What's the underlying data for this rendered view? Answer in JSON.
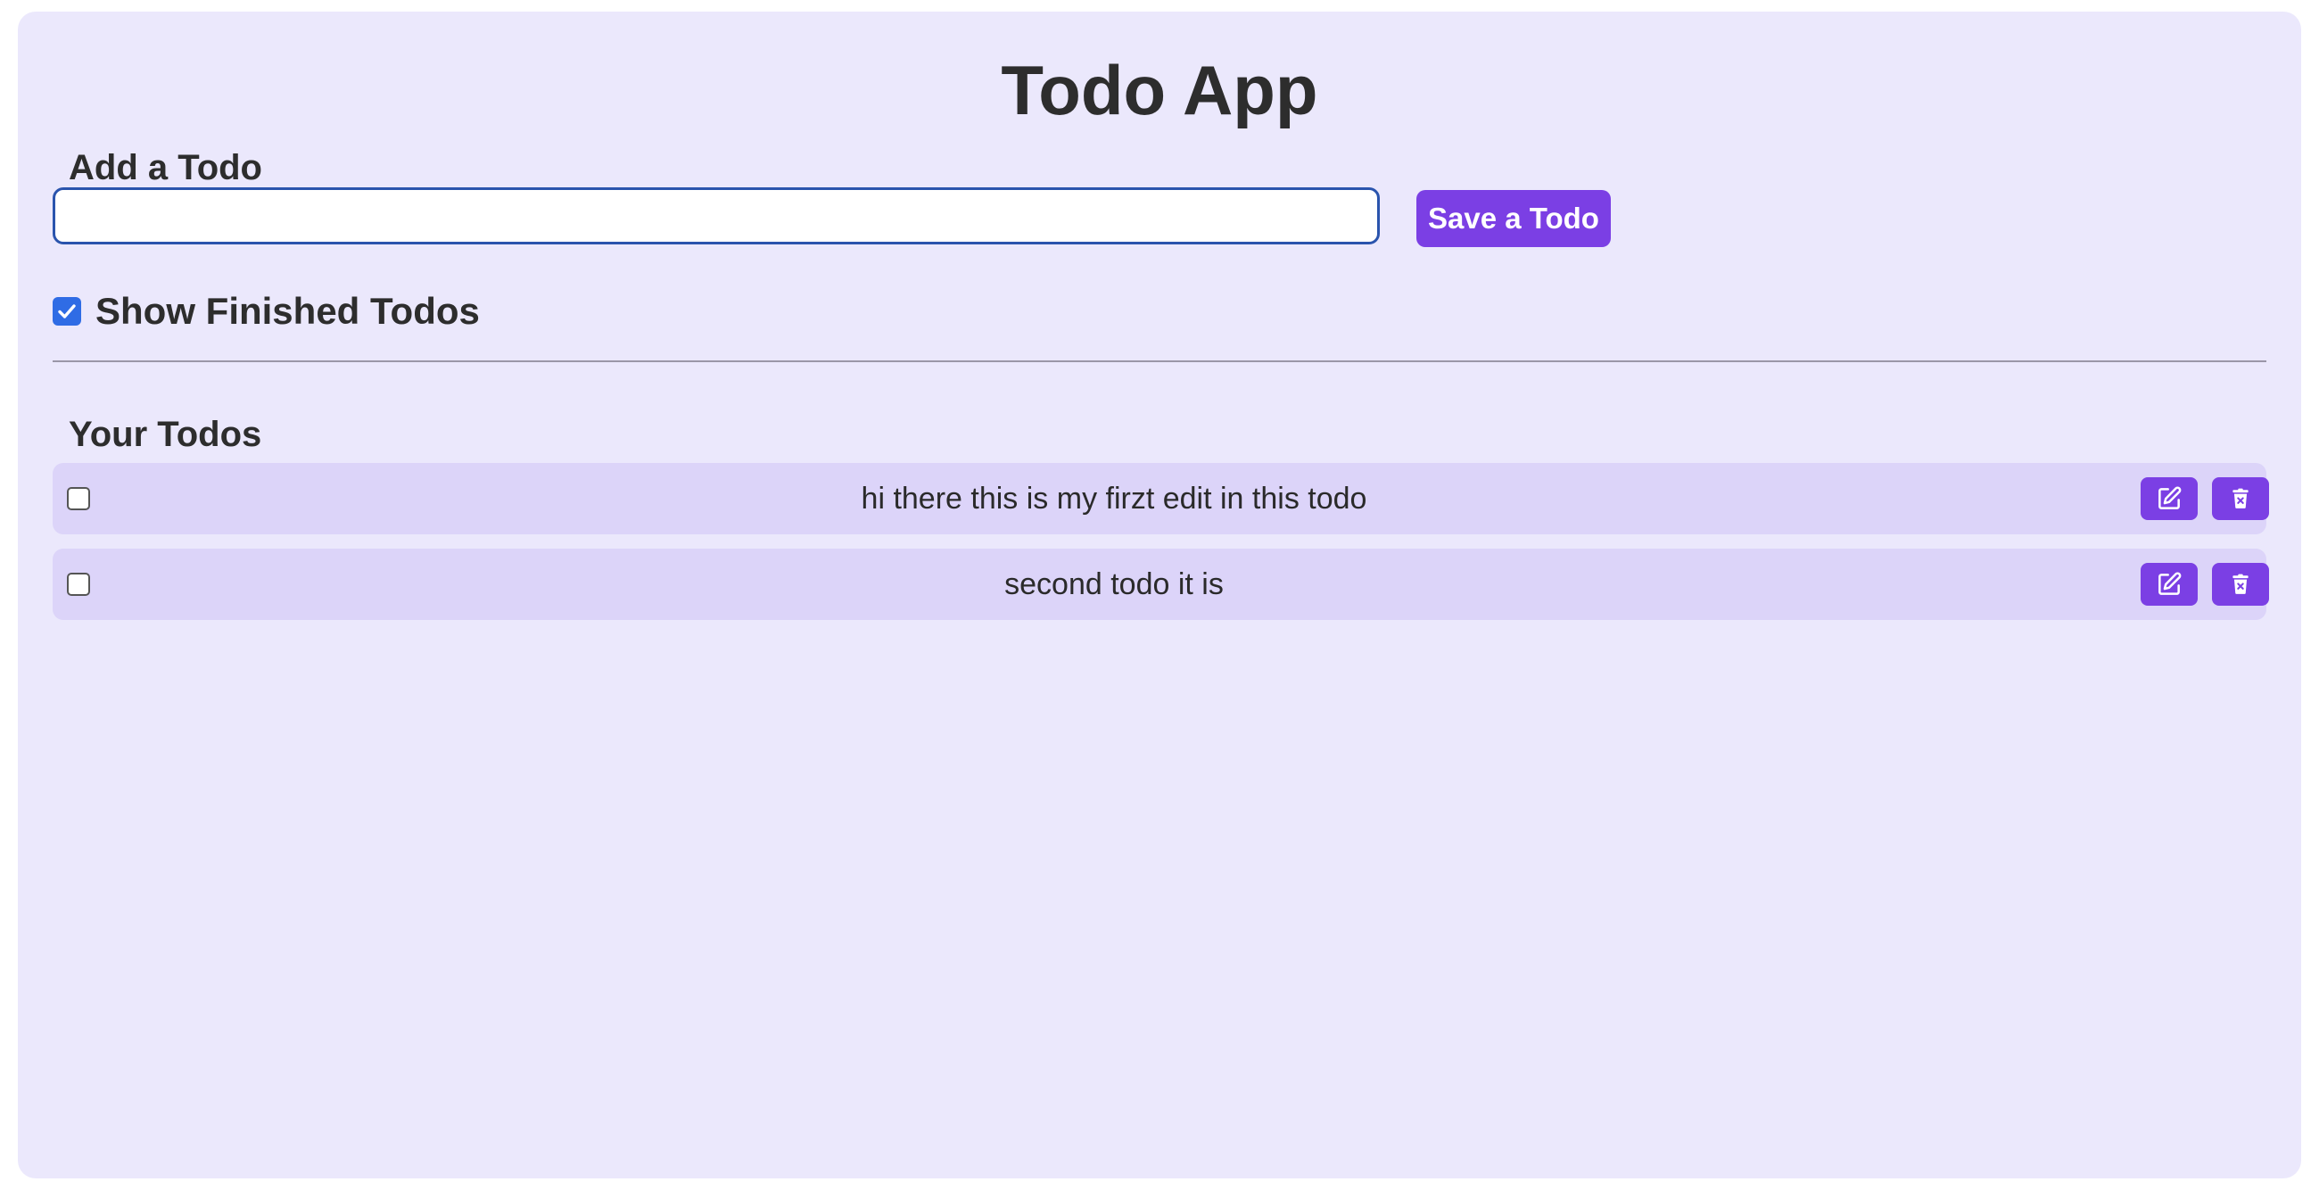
{
  "app": {
    "title": "Todo App"
  },
  "add_section": {
    "heading": "Add a Todo",
    "input_value": "",
    "save_label": "Save a Todo"
  },
  "filter": {
    "show_finished_label": "Show Finished Todos",
    "show_finished_checked": true
  },
  "todos_section": {
    "heading": "Your Todos",
    "items": [
      {
        "text": "hi there this is my firzt edit in this todo",
        "done": false
      },
      {
        "text": "second todo it is",
        "done": false
      }
    ]
  },
  "icons": {
    "edit": "edit-icon",
    "delete": "trash-icon"
  },
  "colors": {
    "card_background": "#ebe8fc",
    "row_background": "#dcd4f9",
    "accent": "#7b3fe4",
    "checkbox_checked": "#2f6ce5",
    "input_border": "#2a54ad"
  }
}
